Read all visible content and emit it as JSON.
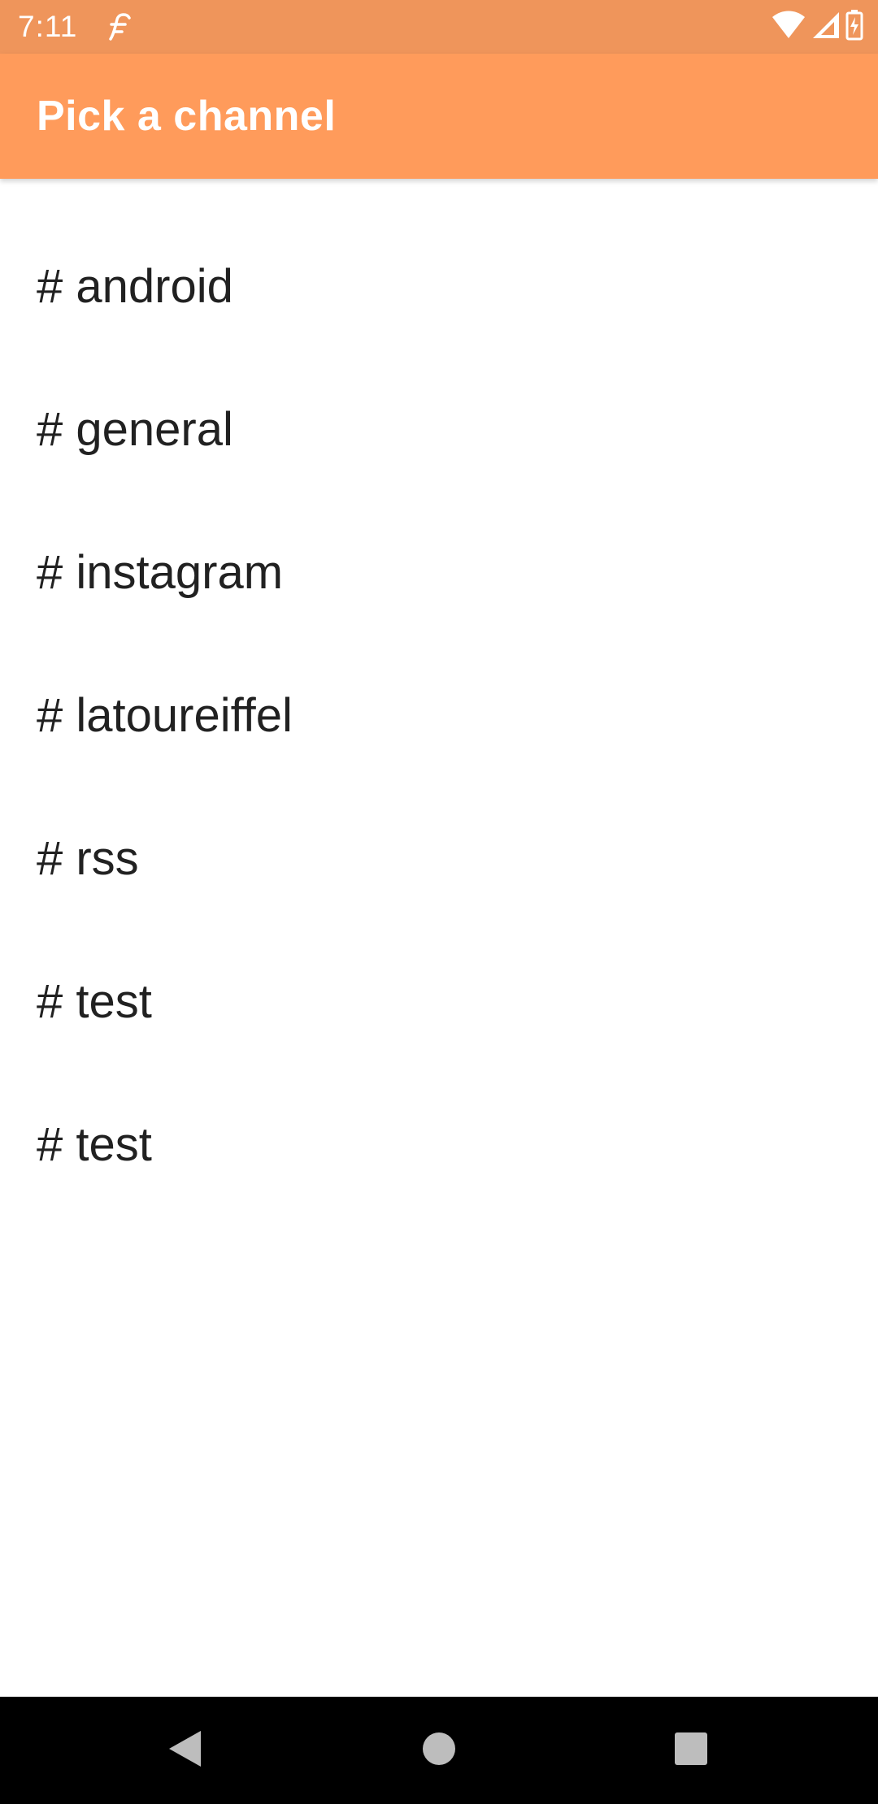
{
  "status_bar": {
    "time": "7:11",
    "app_icon": "feedly-f-icon",
    "icons": [
      "wifi-icon",
      "signal-icon",
      "battery-charging-icon"
    ],
    "color": "#ef955b"
  },
  "app_bar": {
    "title": "Pick a channel",
    "color": "#ff9b5b"
  },
  "channels": [
    {
      "label": "# android"
    },
    {
      "label": "# general"
    },
    {
      "label": "# instagram"
    },
    {
      "label": "# latoureiffel"
    },
    {
      "label": "# rss"
    },
    {
      "label": "# test"
    },
    {
      "label": "# test"
    }
  ],
  "nav_bar": {
    "buttons": [
      "back-icon",
      "home-icon",
      "recents-icon"
    ],
    "color": "#000000"
  }
}
